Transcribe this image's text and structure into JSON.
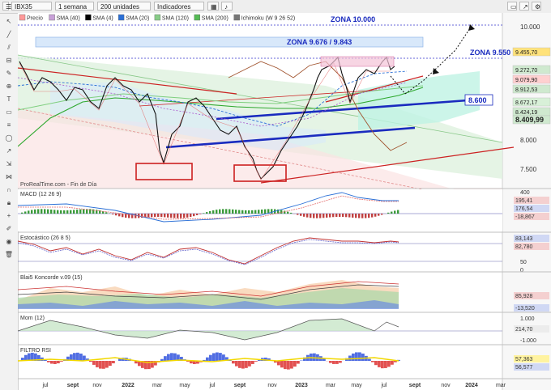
{
  "toolbar": {
    "ticker": "IBX35",
    "timeframe": "1 semana",
    "units": "200 unidades",
    "indicators": "Indicadores"
  },
  "legend": [
    {
      "label": "Precio",
      "color": "#ff9999"
    },
    {
      "label": "SMA (40)",
      "color": "#c8a0d8"
    },
    {
      "label": "SMA (4)",
      "color": "#000000"
    },
    {
      "label": "SMA (20)",
      "color": "#2a6fd6"
    },
    {
      "label": "SMA (120)",
      "color": "#88cc88"
    },
    {
      "label": "SMA (200)",
      "color": "#55bb55"
    },
    {
      "label": "Ichimoku (W 9 26 52)",
      "color": "#777777"
    }
  ],
  "annotations": {
    "zona_10000": "ZONA 10.000",
    "zona_9676": "ZONA 9.676 / 9.843",
    "zona_9550": "ZONA 9.550",
    "level_8600": "8.600",
    "source": "ProRealTime.com - Fin de Día"
  },
  "price_axis": {
    "ticks": [
      "10.000",
      "9.455,70",
      "8.000",
      "7.500"
    ],
    "side_labels": [
      {
        "text": "9.455,70",
        "color": "#ffe27a"
      },
      {
        "text": "9.272,70",
        "color": "#cfe9cf"
      },
      {
        "text": "9.079,90",
        "color": "#ffd0d0"
      },
      {
        "text": "8.912,53",
        "color": "#cfe9cf"
      },
      {
        "text": "8.672,17",
        "color": "#d8f0d8"
      },
      {
        "text": "8.424,19",
        "color": "#cfe9cf"
      },
      {
        "text": "8.409,99",
        "color": "#cfe9cf"
      }
    ]
  },
  "x_axis": [
    "jul",
    "sept",
    "nov",
    "2022",
    "mar",
    "may",
    "jul",
    "sept",
    "nov",
    "2023",
    "mar",
    "may",
    "jul",
    "sept",
    "nov",
    "2024",
    "mar"
  ],
  "panels": [
    {
      "title": "MACD (12 26 9)",
      "ticks": [
        "400",
        "195,41",
        "176,54",
        "-18,867"
      ]
    },
    {
      "title": "Estocástico (26 8 5)",
      "ticks": [
        "83,143",
        "82,780",
        "50",
        "0"
      ]
    },
    {
      "title": "Blai5 Koncorde v.09 (15)",
      "ticks": [
        "85,928",
        "-13,520"
      ]
    },
    {
      "title": "Mom (12)",
      "ticks": [
        "1.000",
        "214,70",
        "-1.000"
      ]
    },
    {
      "title": "FILTRO RSI",
      "ticks": [
        "57,363",
        "56,577"
      ]
    }
  ],
  "chart_data": {
    "type": "line",
    "title": "IBX35",
    "series": [
      {
        "name": "Precio",
        "x": [
          "jul",
          "sept",
          "nov",
          "2022",
          "mar",
          "may",
          "jul",
          "sept",
          "nov",
          "2023",
          "mar",
          "may",
          "jul"
        ],
        "values": [
          8700,
          8900,
          8600,
          8700,
          8100,
          8500,
          8100,
          7500,
          8100,
          8900,
          9300,
          9200,
          9455.7
        ]
      }
    ],
    "ylim": [
      7300,
      10200
    ],
    "levels": [
      10000,
      9843,
      9676,
      9550,
      8600
    ],
    "grid": false,
    "legend": "top-left"
  }
}
